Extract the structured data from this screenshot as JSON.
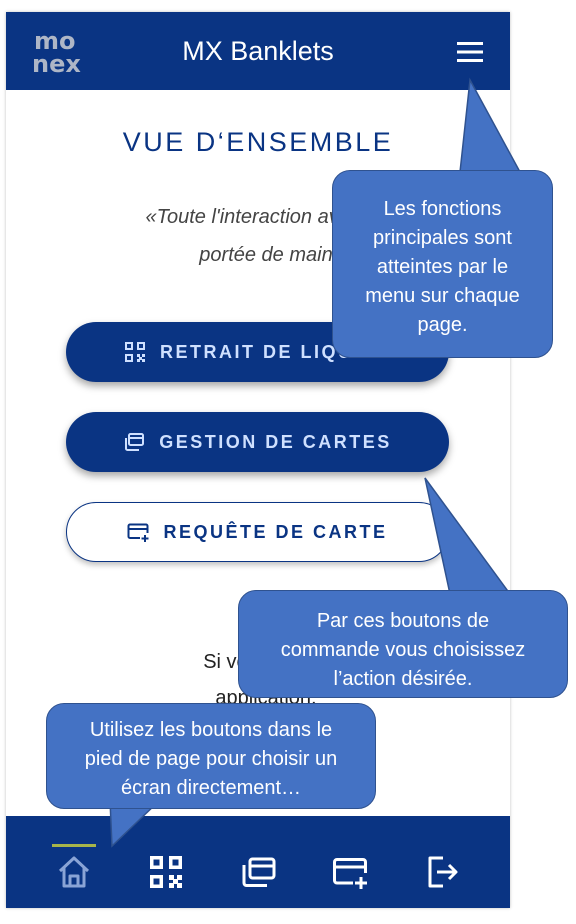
{
  "header": {
    "logo_line1": "mo",
    "logo_line2": "nex",
    "title": "MX Banklets",
    "menu_icon": "hamburger-menu-icon"
  },
  "main": {
    "page_title": "VUE D‘ENSEMBLE",
    "quote": "«Toute l'interaction avec vo\nportée de main",
    "buttons": [
      {
        "label": "RETRAIT DE LIQUIDE",
        "icon": "qr-code-icon",
        "style": "solid"
      },
      {
        "label": "GESTION DE CARTES",
        "icon": "cards-stack-icon",
        "style": "solid"
      },
      {
        "label": "REQUÊTE DE CARTE",
        "icon": "card-add-icon",
        "style": "outline"
      }
    ],
    "body_text": "Si vous êtes n\napplication,\nder à"
  },
  "footer": {
    "items": [
      {
        "icon": "home-icon",
        "active": true
      },
      {
        "icon": "qr-code-icon",
        "active": false
      },
      {
        "icon": "cards-stack-icon",
        "active": false
      },
      {
        "icon": "card-add-icon",
        "active": false
      },
      {
        "icon": "logout-icon",
        "active": false
      }
    ]
  },
  "callouts": {
    "menu_tip": "Les fonctions\nprincipales sont\natteintes par le\nmenu sur chaque\npage.",
    "buttons_tip": "Par ces boutons de\ncommande vous choisissez\nl’action désirée.",
    "footer_tip": "Utilisez les boutons dans le\npied de page pour choisir un\nécran directement…"
  },
  "colors": {
    "primary": "#0a3483",
    "button_text": "#cfe0ff",
    "callout_fill": "#4472c4",
    "callout_border": "#2f528f",
    "active_indicator": "#a7b54a"
  }
}
